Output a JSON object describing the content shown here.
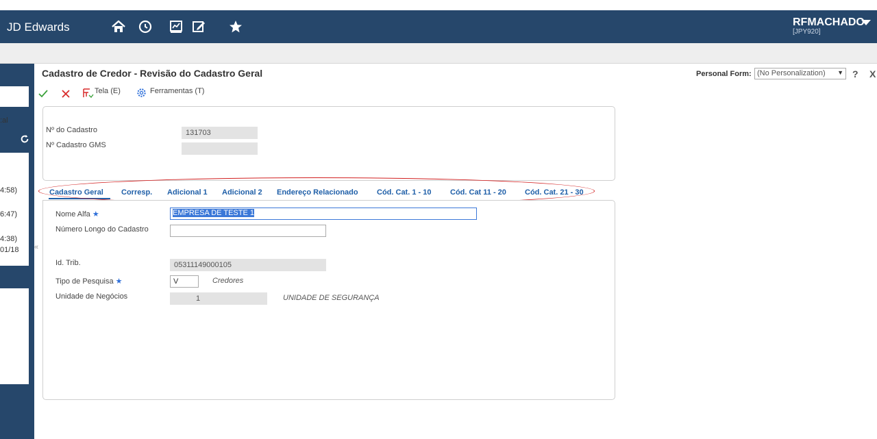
{
  "app": {
    "brand": "JD Edwards",
    "user_name": "RFMACHADO",
    "user_env": "[JPY920]"
  },
  "left_panel": {
    "items": [
      ":al",
      "4:58)",
      "6:47)",
      "4:38)",
      "01/18"
    ]
  },
  "form": {
    "title": "Cadastro de Credor - Revisão do Cadastro Geral",
    "personal_form_label": "Personal Form:",
    "personal_form_value": "(No Personalization)",
    "help": "?",
    "close": "X"
  },
  "toolbar": {
    "tela": "Tela (E)",
    "ferramentas": "Ferramentas (T)"
  },
  "header_fields": {
    "cadastro_label": "Nº do Cadastro",
    "cadastro_value": "131703",
    "gms_label": "Nº Cadastro GMS",
    "gms_value": ""
  },
  "tabs": [
    "Cadastro Geral",
    "Corresp.",
    "Adicional 1",
    "Adicional 2",
    "Endereço Relacionado",
    "Cód. Cat. 1 - 10",
    "Cód. Cat 11 - 20",
    "Cód. Cat. 21 - 30"
  ],
  "general": {
    "nome_alfa_label": "Nome Alfa",
    "nome_alfa_value": "EMPRESA DE TESTE 1",
    "numero_longo_label": "Número Longo do Cadastro",
    "numero_longo_value": "",
    "id_trib_label": "Id. Trib.",
    "id_trib_value": "05311149000105",
    "tipo_pesquisa_label": "Tipo de Pesquisa",
    "tipo_pesquisa_value": "V",
    "tipo_pesquisa_desc": "Credores",
    "unidade_label": "Unidade de Negócios",
    "unidade_value": "1",
    "unidade_desc": "UNIDADE DE SEGURANÇA",
    "required_mark": "★"
  },
  "colors": {
    "header": "#26476b",
    "tab_link": "#1f5fa8",
    "highlight_ellipse": "#d21f1f",
    "ok_check": "#3aa13a",
    "cancel_x": "#d92b2b",
    "selection": "#3b78d8"
  }
}
